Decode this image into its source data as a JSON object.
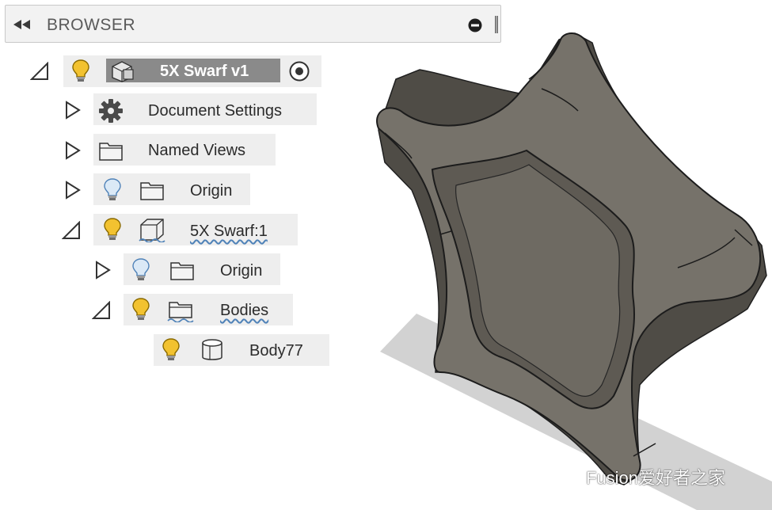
{
  "browser": {
    "title": "BROWSER",
    "tree": {
      "root": {
        "label": "5X Swarf v1",
        "expanded": true
      },
      "document_settings": {
        "label": "Document Settings",
        "expanded": false
      },
      "named_views": {
        "label": "Named Views",
        "expanded": false
      },
      "origin_root": {
        "label": "Origin",
        "expanded": false
      },
      "component": {
        "label": "5X Swarf:1",
        "expanded": true
      },
      "component_origin": {
        "label": "Origin",
        "expanded": false
      },
      "bodies": {
        "label": "Bodies",
        "expanded": true
      },
      "body": {
        "label": "Body77"
      }
    }
  },
  "watermark": {
    "text": "Fusion爱好者之家"
  },
  "colors": {
    "bulb_on": "#f2c230",
    "bulb_off": "#9fc3e6",
    "model_face": "#76726a",
    "model_dark": "#4f4c46",
    "shadow": "#d2d2d2",
    "row_bg": "#eeeeee",
    "active_box": "#8a8a8a"
  }
}
